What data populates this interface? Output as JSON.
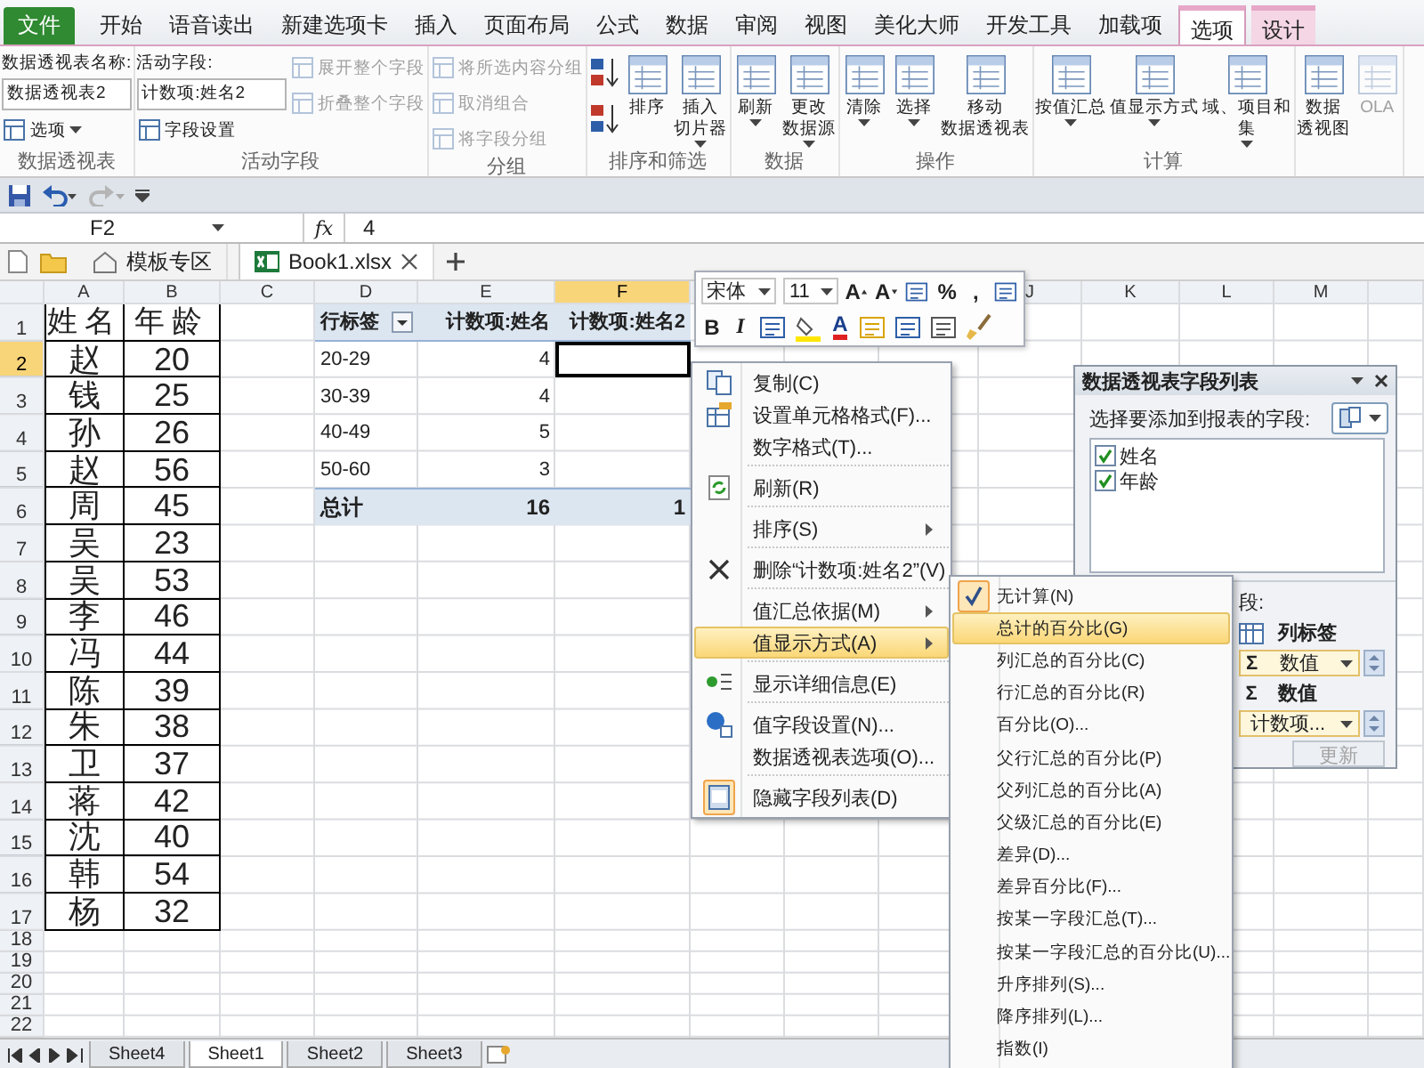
{
  "ribbon": {
    "tabs": [
      {
        "label": "文件",
        "kind": "file",
        "selected": false
      },
      {
        "label": "开始",
        "kind": "normal",
        "selected": false
      },
      {
        "label": "语音读出",
        "kind": "normal",
        "selected": false
      },
      {
        "label": "新建选项卡",
        "kind": "normal",
        "selected": false
      },
      {
        "label": "插入",
        "kind": "normal",
        "selected": false
      },
      {
        "label": "页面布局",
        "kind": "normal",
        "selected": false
      },
      {
        "label": "公式",
        "kind": "normal",
        "selected": false
      },
      {
        "label": "数据",
        "kind": "normal",
        "selected": false
      },
      {
        "label": "审阅",
        "kind": "normal",
        "selected": false
      },
      {
        "label": "视图",
        "kind": "normal",
        "selected": false
      },
      {
        "label": "美化大师",
        "kind": "normal",
        "selected": false
      },
      {
        "label": "开发工具",
        "kind": "normal",
        "selected": false
      },
      {
        "label": "加载项",
        "kind": "normal",
        "selected": false
      },
      {
        "label": "选项",
        "kind": "context",
        "selected": true
      },
      {
        "label": "设计",
        "kind": "context",
        "selected": false
      }
    ],
    "groups": [
      {
        "label": "数据透视表",
        "columns": [
          [
            {
              "kind": "field",
              "label": "数据透视表名称:",
              "value": "数据透视表2"
            },
            {
              "kind": "small",
              "label": "选项",
              "menu": true,
              "disabled": false
            }
          ]
        ]
      },
      {
        "label": "活动字段",
        "columns": [
          [
            {
              "kind": "field",
              "label": "活动字段:",
              "value": "计数项:姓名2"
            },
            {
              "kind": "small",
              "label": "字段设置",
              "menu": false,
              "disabled": false
            }
          ],
          [
            {
              "kind": "small",
              "label": "展开整个字段",
              "menu": false,
              "disabled": true
            },
            {
              "kind": "small",
              "label": "折叠整个字段",
              "menu": false,
              "disabled": true
            }
          ]
        ]
      },
      {
        "label": "分组",
        "columns": [
          [
            {
              "kind": "small",
              "label": "将所选内容分组",
              "menu": false,
              "disabled": true
            },
            {
              "kind": "small",
              "label": "取消组合",
              "menu": false,
              "disabled": true
            },
            {
              "kind": "small",
              "label": "将字段分组",
              "menu": false,
              "disabled": true
            }
          ]
        ]
      },
      {
        "label": "排序和筛选",
        "columns": [
          [
            {
              "kind": "icon"
            },
            {
              "kind": "icon"
            }
          ],
          [
            {
              "kind": "large",
              "lines": [
                "排序"
              ],
              "menu": false,
              "disabled": false
            }
          ],
          [
            {
              "kind": "large",
              "lines": [
                "插入",
                "切片器"
              ],
              "menu": true,
              "disabled": false
            }
          ]
        ]
      },
      {
        "label": "数据",
        "columns": [
          [
            {
              "kind": "large",
              "lines": [
                "刷新"
              ],
              "menu": true,
              "disabled": false
            }
          ],
          [
            {
              "kind": "large",
              "lines": [
                "更改",
                "数据源"
              ],
              "menu": true,
              "disabled": false
            }
          ]
        ]
      },
      {
        "label": "操作",
        "columns": [
          [
            {
              "kind": "large",
              "lines": [
                "清除"
              ],
              "menu": true,
              "disabled": false
            }
          ],
          [
            {
              "kind": "large",
              "lines": [
                "选择"
              ],
              "menu": true,
              "disabled": false
            }
          ],
          [
            {
              "kind": "large",
              "lines": [
                "移动",
                "数据透视表"
              ],
              "menu": false,
              "disabled": false
            }
          ]
        ]
      },
      {
        "label": "计算",
        "columns": [
          [
            {
              "kind": "large",
              "lines": [
                "按值汇总"
              ],
              "menu": true,
              "disabled": false
            }
          ],
          [
            {
              "kind": "large",
              "lines": [
                "值显示方式"
              ],
              "menu": true,
              "disabled": false
            }
          ],
          [
            {
              "kind": "large",
              "lines": [
                "域、项目和",
                "集"
              ],
              "menu": true,
              "disabled": false
            }
          ]
        ]
      },
      {
        "columns": [
          [
            {
              "kind": "large",
              "lines": [
                "数据",
                "透视图"
              ],
              "menu": false,
              "disabled": false
            }
          ],
          [
            {
              "kind": "large",
              "lines": [
                "OLA"
              ],
              "menu": false,
              "disabled": true
            }
          ]
        ]
      }
    ]
  },
  "formula_bar": {
    "name_box": "F2",
    "fx": "fx",
    "value": "4"
  },
  "doc_tabs": [
    {
      "label": "模板专区",
      "selected": false,
      "kind": "home"
    },
    {
      "label": "Book1.xlsx",
      "selected": true,
      "kind": "workbook"
    }
  ],
  "sheet": {
    "columns": [
      {
        "label": "A",
        "selected": false
      },
      {
        "label": "B",
        "selected": false
      },
      {
        "label": "C",
        "selected": false
      },
      {
        "label": "D",
        "selected": false
      },
      {
        "label": "E",
        "selected": false
      },
      {
        "label": "F",
        "selected": true
      },
      {},
      {},
      {},
      {
        "label": "J",
        "selected": false
      },
      {
        "label": "K",
        "selected": false
      },
      {
        "label": "L",
        "selected": false
      },
      {
        "label": "M",
        "selected": false
      },
      {
        "selected": false
      }
    ],
    "rows": [
      {
        "label": "1",
        "selected": false
      },
      {
        "label": "2",
        "selected": true
      },
      {
        "label": "3",
        "selected": false
      },
      {
        "label": "4",
        "selected": false
      },
      {
        "label": "5",
        "selected": false
      },
      {
        "label": "6",
        "selected": false
      },
      {
        "label": "7",
        "selected": false
      },
      {
        "label": "8",
        "selected": false
      },
      {
        "label": "9",
        "selected": false
      },
      {
        "label": "10",
        "selected": false
      },
      {
        "label": "11",
        "selected": false
      },
      {
        "label": "12",
        "selected": false
      },
      {
        "label": "13",
        "selected": false
      },
      {
        "label": "14",
        "selected": false
      },
      {
        "label": "15",
        "selected": false
      },
      {
        "label": "16",
        "selected": false
      },
      {
        "label": "17",
        "selected": false
      },
      {
        "label": "18",
        "selected": false
      },
      {
        "label": "19",
        "selected": false
      },
      {
        "label": "20",
        "selected": false
      },
      {
        "label": "21",
        "selected": false
      },
      {
        "label": "22",
        "selected": false
      }
    ],
    "source_table": {
      "header": [
        "姓名",
        "年龄"
      ],
      "rows": [
        [
          "赵",
          "20"
        ],
        [
          "钱",
          "25"
        ],
        [
          "孙",
          "26"
        ],
        [
          "赵",
          "56"
        ],
        [
          "周",
          "45"
        ],
        [
          "吴",
          "23"
        ],
        [
          "吴",
          "53"
        ],
        [
          "李",
          "46"
        ],
        [
          "冯",
          "44"
        ],
        [
          "陈",
          "39"
        ],
        [
          "朱",
          "38"
        ],
        [
          "卫",
          "37"
        ],
        [
          "蒋",
          "42"
        ],
        [
          "沈",
          "40"
        ],
        [
          "韩",
          "54"
        ],
        [
          "杨",
          "32"
        ]
      ]
    },
    "pivot": {
      "header": [
        "行标签",
        "计数项:姓名",
        "计数项:姓名2"
      ],
      "rows": [
        [
          "20-29",
          "4"
        ],
        [
          "30-39",
          "4"
        ],
        [
          "40-49",
          "5"
        ],
        [
          "50-60",
          "3"
        ]
      ],
      "total": [
        "总计",
        "16",
        "1"
      ]
    },
    "sheet_tabs": [
      {
        "label": "Sheet4",
        "selected": false
      },
      {
        "label": "Sheet1",
        "selected": true
      },
      {
        "label": "Sheet2",
        "selected": false
      },
      {
        "label": "Sheet3",
        "selected": false
      }
    ]
  },
  "mini_toolbar": {
    "font": "宋体",
    "size": "11",
    "rows": [
      [
        {
          "kind": "text",
          "label": "A"
        },
        {
          "kind": "text",
          "label": "A"
        },
        {
          "kind": "icon"
        },
        {
          "kind": "text",
          "label": "%"
        },
        {
          "kind": "text",
          "label": ","
        },
        {
          "kind": "icon"
        }
      ],
      [
        {
          "kind": "text",
          "label": "B"
        },
        {
          "kind": "text",
          "label": "I"
        },
        {
          "kind": "icon"
        },
        {
          "kind": "icon"
        },
        {
          "kind": "text",
          "label": "A"
        },
        {
          "kind": "icon"
        },
        {
          "kind": "icon"
        },
        {
          "kind": "icon"
        },
        {
          "kind": "icon"
        }
      ]
    ]
  },
  "context_menu": [
    {
      "kind": "item",
      "label": "复制(C)",
      "selected": false,
      "checked": false
    },
    {
      "kind": "item",
      "label": "设置单元格格式(F)...",
      "selected": false,
      "checked": false
    },
    {
      "kind": "item",
      "label": "数字格式(T)...",
      "selected": false,
      "checked": false
    },
    {
      "kind": "separator"
    },
    {
      "kind": "item",
      "label": "刷新(R)",
      "selected": false,
      "checked": false
    },
    {
      "kind": "separator"
    },
    {
      "kind": "submenu",
      "label": "排序(S)",
      "selected": false,
      "checked": false
    },
    {
      "kind": "separator"
    },
    {
      "kind": "item",
      "label": "删除“计数项:姓名2”(V)",
      "selected": false,
      "checked": false
    },
    {
      "kind": "separator"
    },
    {
      "kind": "submenu",
      "label": "值汇总依据(M)",
      "selected": false,
      "checked": false
    },
    {
      "kind": "submenu",
      "label": "值显示方式(A)",
      "selected": true,
      "checked": false
    },
    {
      "kind": "separator"
    },
    {
      "kind": "item",
      "label": "显示详细信息(E)",
      "selected": false,
      "checked": false
    },
    {
      "kind": "separator"
    },
    {
      "kind": "item",
      "label": "值字段设置(N)...",
      "selected": false,
      "checked": false
    },
    {
      "kind": "item",
      "label": "数据透视表选项(O)...",
      "selected": false,
      "checked": false
    },
    {
      "kind": "separator"
    },
    {
      "kind": "item",
      "label": "隐藏字段列表(D)",
      "selected": false,
      "checked": true
    }
  ],
  "submenu": [
    {
      "label": "无计算(N)",
      "selected": false,
      "checked": true
    },
    {
      "label": "总计的百分比(G)",
      "selected": true,
      "checked": false
    },
    {
      "label": "列汇总的百分比(C)",
      "selected": false,
      "checked": false
    },
    {
      "label": "行汇总的百分比(R)",
      "selected": false,
      "checked": false
    },
    {
      "label": "百分比(O)...",
      "selected": false,
      "checked": false
    },
    {
      "label": "父行汇总的百分比(P)",
      "selected": false,
      "checked": false
    },
    {
      "label": "父列汇总的百分比(A)",
      "selected": false,
      "checked": false
    },
    {
      "label": "父级汇总的百分比(E)",
      "selected": false,
      "checked": false
    },
    {
      "label": "差异(D)...",
      "selected": false,
      "checked": false
    },
    {
      "label": "差异百分比(F)...",
      "selected": false,
      "checked": false
    },
    {
      "label": "按某一字段汇总(T)...",
      "selected": false,
      "checked": false
    },
    {
      "label": "按某一字段汇总的百分比(U)...",
      "selected": false,
      "checked": false
    },
    {
      "label": "升序排列(S)...",
      "selected": false,
      "checked": false
    },
    {
      "label": "降序排列(L)...",
      "selected": false,
      "checked": false
    },
    {
      "label": "指数(I)",
      "selected": false,
      "checked": false
    }
  ],
  "field_list": {
    "title": "数据透视表字段列表",
    "prompt": "选择要添加到报表的字段:",
    "fields": [
      {
        "label": "姓名",
        "checked": true
      },
      {
        "label": "年龄",
        "checked": true
      }
    ],
    "areas_hint": "段:",
    "areas": [
      {
        "kind": "area",
        "label": "列标签"
      },
      {
        "kind": "chip",
        "symbol": "Σ",
        "label": "数值"
      },
      {
        "kind": "area",
        "symbol": "Σ",
        "label": "数值"
      },
      {
        "kind": "chip",
        "label": "计数项..."
      }
    ],
    "update_button": {
      "label": "更新",
      "disabled": true
    }
  }
}
